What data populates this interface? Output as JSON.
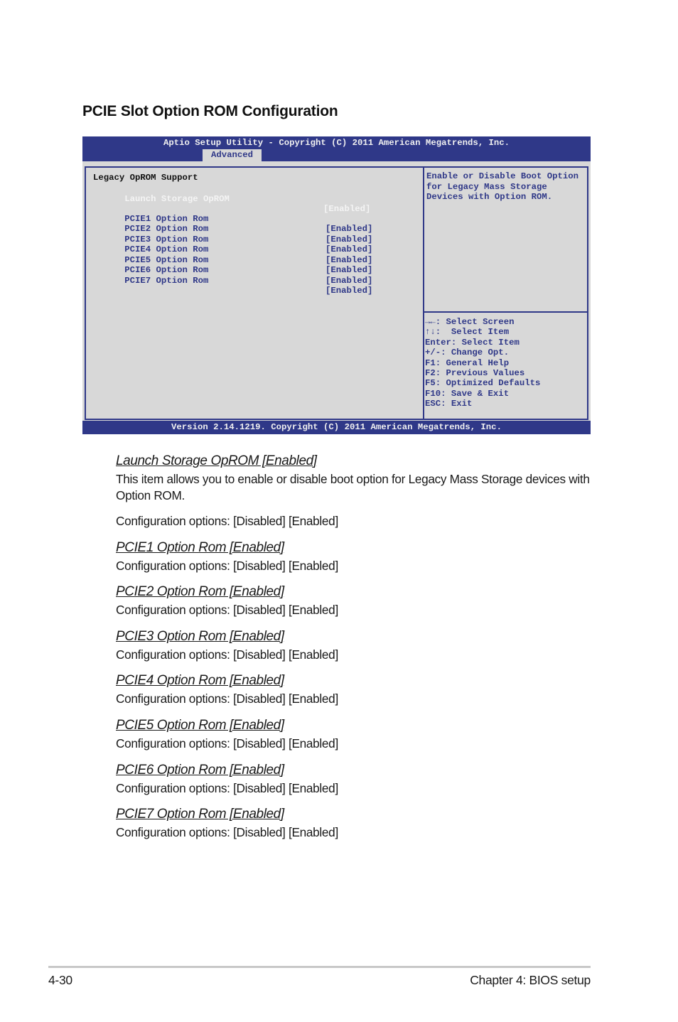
{
  "section_title": "PCIE Slot Option ROM Configuration",
  "bios": {
    "title": "Aptio Setup Utility - Copyright (C) 2011 American Megatrends, Inc.",
    "active_tab": "Advanced",
    "menu": {
      "heading": "Legacy OpROM Support",
      "items": [
        {
          "label": "Launch Storage OpROM",
          "value": "[Enabled]",
          "selected": true
        },
        {
          "label": "PCIE1 Option Rom",
          "value": "[Enabled]"
        },
        {
          "label": "PCIE2 Option Rom",
          "value": "[Enabled]"
        },
        {
          "label": "PCIE3 Option Rom",
          "value": "[Enabled]"
        },
        {
          "label": "PCIE4 Option Rom",
          "value": "[Enabled]"
        },
        {
          "label": "PCIE5 Option Rom",
          "value": "[Enabled]"
        },
        {
          "label": "PCIE6 Option Rom",
          "value": "[Enabled]"
        },
        {
          "label": "PCIE7 Option Rom",
          "value": "[Enabled]"
        }
      ]
    },
    "help_text": [
      "Enable or Disable Boot Option",
      "for Legacy Mass Storage",
      "Devices with Option ROM."
    ],
    "key_hints": [
      "→←: Select Screen",
      "↑↓:  Select Item",
      "Enter: Select Item",
      "+/-: Change Opt.",
      "F1: General Help",
      "F2: Previous Values",
      "F5: Optimized Defaults",
      "F10: Save & Exit",
      "ESC: Exit"
    ],
    "footer": "Version 2.14.1219. Copyright (C) 2011 American Megatrends, Inc.",
    "colors": {
      "primary": "#2f3888",
      "panel": "#d8d8d8",
      "highlight": "#f4f4f4"
    }
  },
  "descriptions": [
    {
      "title": "Launch Storage OpROM [Enabled]",
      "body": "This item allows you to enable or disable boot option for Legacy Mass Storage devices with Option ROM.",
      "options": "Configuration options: [Disabled] [Enabled]"
    },
    {
      "title": "PCIE1 Option Rom [Enabled]",
      "options": "Configuration options: [Disabled] [Enabled]"
    },
    {
      "title": "PCIE2 Option Rom [Enabled]",
      "options": "Configuration options: [Disabled] [Enabled]"
    },
    {
      "title": "PCIE3 Option Rom [Enabled]",
      "options": "Configuration options: [Disabled] [Enabled]"
    },
    {
      "title": "PCIE4 Option Rom [Enabled]",
      "options": "Configuration options: [Disabled] [Enabled]"
    },
    {
      "title": "PCIE5 Option Rom [Enabled]",
      "options": "Configuration options: [Disabled] [Enabled]"
    },
    {
      "title": "PCIE6 Option Rom [Enabled]",
      "options": "Configuration options: [Disabled] [Enabled]"
    },
    {
      "title": "PCIE7 Option Rom [Enabled]",
      "options": "Configuration options: [Disabled] [Enabled]"
    }
  ],
  "footer": {
    "page_number": "4-30",
    "chapter": "Chapter 4: BIOS setup"
  }
}
